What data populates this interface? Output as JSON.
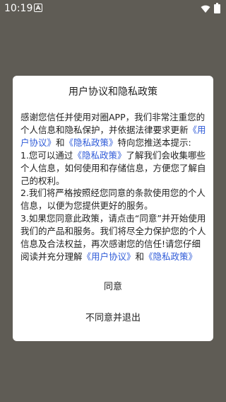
{
  "status_bar": {
    "time": "10:19",
    "icons": [
      "a-icon",
      "wifi-icon",
      "battery-icon"
    ]
  },
  "dialog": {
    "title": "用户协议和隐私政策",
    "paragraphs": {
      "p1_prefix": "感谢您信任并使用对圈APP，我们非常注重您的个人信息和隐私保护，并依据法律要求更新",
      "p1_link1": "《用户协议》",
      "p1_and": "和",
      "p1_link2": "《隐私政策》",
      "p1_suffix": "特向您推送本提示:",
      "p2_prefix": "1.您可以通过",
      "p2_link": "《隐私政策》",
      "p2_suffix": "了解我们会收集哪些个人信息，如何使用和存储信息，方便您了解自己的权利。",
      "p3": "2.我们将严格按照经您同意的条款使用您的个人信息，以便为您提供更好的服务。",
      "p4_prefix": "3.如果您同意此政策，请点击“同意”并开始使用我们的产品和服务。我们将尽全力保护您的个人信息及合法权益，再次感谢您的信任!请您仔细阅读并充分理解",
      "p4_link1": "《用户协议》",
      "p4_and": "和",
      "p4_link2": "《隐私政策》"
    },
    "agree_label": "同意",
    "disagree_label": "不同意并退出"
  },
  "colors": {
    "backdrop": "#5f5c55",
    "link": "#2f5bd8",
    "text": "#222222"
  }
}
